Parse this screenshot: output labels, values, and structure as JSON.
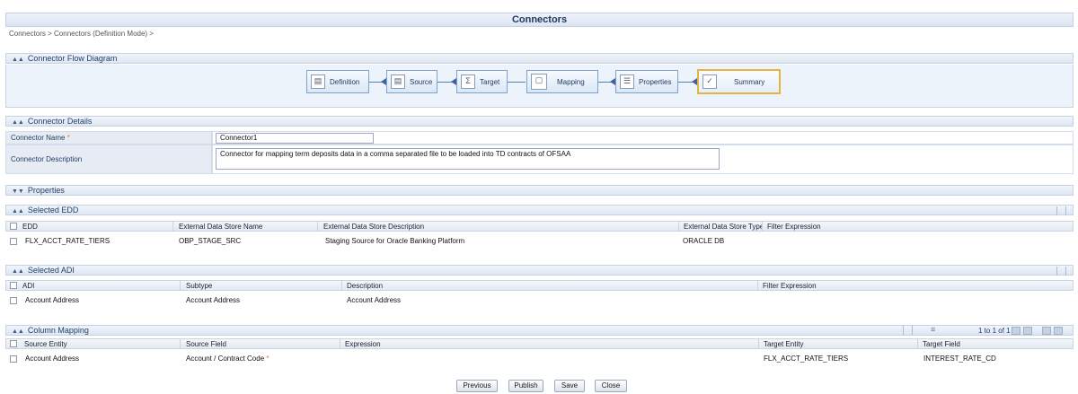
{
  "header": {
    "title": "Connectors",
    "breadcrumb": "Connectors > Connectors (Definition Mode) >"
  },
  "flow": {
    "section_title": "Connector Flow Diagram",
    "nodes": [
      {
        "label": "Definition",
        "icon": "document-icon"
      },
      {
        "label": "Source",
        "icon": "database-icon"
      },
      {
        "label": "Target",
        "icon": "sigma-icon"
      },
      {
        "label": "Mapping",
        "icon": "mapping-icon"
      },
      {
        "label": "Properties",
        "icon": "properties-icon"
      },
      {
        "label": "Summary",
        "icon": "summary-icon"
      }
    ]
  },
  "details": {
    "section_title": "Connector Details",
    "name_label": "Connector Name",
    "name_required": "*",
    "name_value": "Connector1",
    "desc_label": "Connector Description",
    "desc_value": "Connector for mapping term deposits data in a comma separated file to be loaded into TD contracts of OFSAA"
  },
  "properties": {
    "section_title": "Properties"
  },
  "edd": {
    "section_title": "Selected EDD",
    "columns": [
      "EDD",
      "External Data Store Name",
      "External Data Store Description",
      "External Data Store Type",
      "Filter Expression"
    ],
    "rows": [
      [
        "FLX_ACCT_RATE_TIERS",
        "OBP_STAGE_SRC",
        "Staging Source for Oracle Banking Platform",
        "ORACLE DB",
        ""
      ]
    ]
  },
  "adi": {
    "section_title": "Selected ADI",
    "columns": [
      "ADI",
      "Subtype",
      "Description",
      "Filter Expression"
    ],
    "rows": [
      [
        "Account Address",
        "Account Address",
        "Account Address",
        ""
      ]
    ]
  },
  "mapping": {
    "section_title": "Column Mapping",
    "pager": "1 to 1 of 1",
    "columns": [
      "Source Entity",
      "Source Field",
      "Expression",
      "Target Entity",
      "Target Field"
    ],
    "rows": [
      [
        "Account Address",
        "Account / Contract Code",
        "",
        "FLX_ACCT_RATE_TIERS",
        "INTEREST_RATE_CD"
      ]
    ],
    "required": "*"
  },
  "buttons": {
    "previous": "Previous",
    "publish": "Publish",
    "save": "Save",
    "close": "Close"
  },
  "colors": {
    "accent": "#1f3b63",
    "active_node_border": "#e6b340",
    "required": "#e07b1e"
  }
}
